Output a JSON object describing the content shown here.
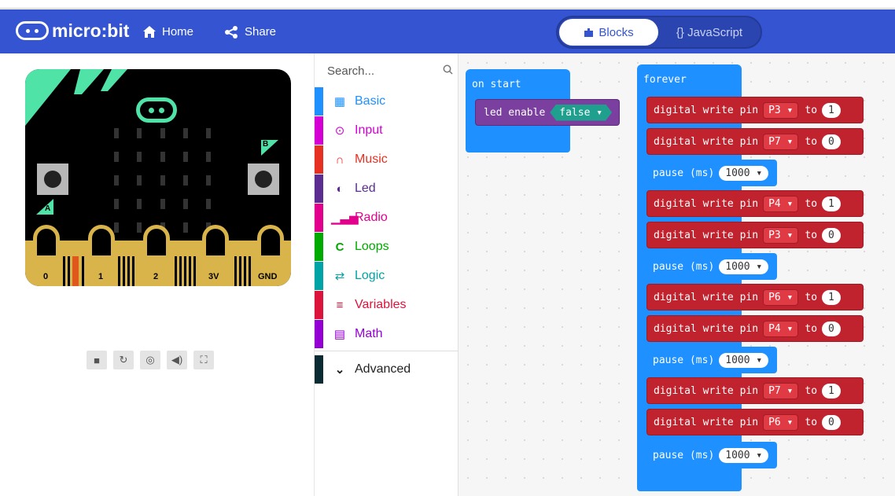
{
  "header": {
    "brand": "micro:bit",
    "home_label": "Home",
    "share_label": "Share",
    "mode_blocks": "Blocks",
    "mode_js": "{} JavaScript"
  },
  "simulator": {
    "pins": [
      "0",
      "1",
      "2",
      "3V",
      "GND"
    ],
    "button_a": "A",
    "button_b": "B",
    "controls": [
      "stop-icon",
      "restart-icon",
      "slow-mo-icon",
      "mute-icon",
      "fullscreen-icon"
    ]
  },
  "toolbox": {
    "search_placeholder": "Search...",
    "categories": [
      {
        "label": "Basic",
        "color": "#1e90ff"
      },
      {
        "label": "Input",
        "color": "#d400d4"
      },
      {
        "label": "Music",
        "color": "#e63022"
      },
      {
        "label": "Led",
        "color": "#5c2d91"
      },
      {
        "label": "Radio",
        "color": "#e3008c"
      },
      {
        "label": "Loops",
        "color": "#00aa00"
      },
      {
        "label": "Logic",
        "color": "#00a4a6"
      },
      {
        "label": "Variables",
        "color": "#dc143c"
      },
      {
        "label": "Math",
        "color": "#9400d3"
      }
    ],
    "advanced": "Advanced"
  },
  "workspace": {
    "on_start": "on start",
    "led_enable": "led enable",
    "led_value": "false ▾",
    "forever": "forever",
    "dw_label": "digital write pin",
    "to_label": "to",
    "pause_label": "pause (ms)",
    "forever_blocks": [
      {
        "type": "dw",
        "pin": "P3 ▾",
        "value": "1"
      },
      {
        "type": "dw",
        "pin": "P7 ▾",
        "value": "0"
      },
      {
        "type": "pause",
        "value": "1000 ▾"
      },
      {
        "type": "dw",
        "pin": "P4 ▾",
        "value": "1"
      },
      {
        "type": "dw",
        "pin": "P3 ▾",
        "value": "0"
      },
      {
        "type": "pause",
        "value": "1000 ▾"
      },
      {
        "type": "dw",
        "pin": "P6 ▾",
        "value": "1"
      },
      {
        "type": "dw",
        "pin": "P4 ▾",
        "value": "0"
      },
      {
        "type": "pause",
        "value": "1000 ▾"
      },
      {
        "type": "dw",
        "pin": "P7 ▾",
        "value": "1"
      },
      {
        "type": "dw",
        "pin": "P6 ▾",
        "value": "0"
      },
      {
        "type": "pause",
        "value": "1000 ▾"
      }
    ]
  }
}
